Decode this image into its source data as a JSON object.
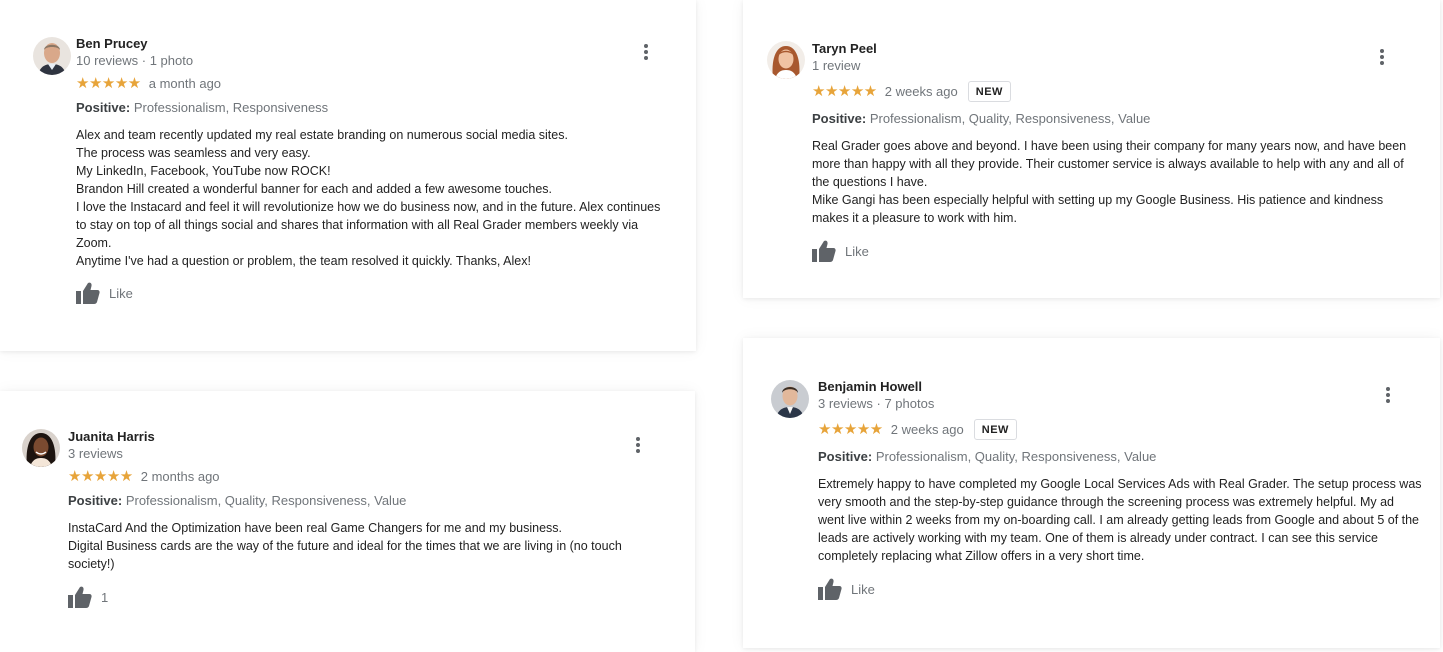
{
  "reviews": {
    "ben": {
      "name": "Ben Prucey",
      "meta": "10 reviews · 1 photo",
      "stars": "★★★★★",
      "time": "a month ago",
      "positive_label": "Positive:",
      "positive_values": "Professionalism, Responsiveness",
      "lines": [
        "Alex and team recently updated my real estate branding on numerous social media sites.",
        "The process was seamless and very easy.",
        "My LinkedIn, Facebook, YouTube now ROCK!",
        "Brandon Hill created a wonderful banner for each and added a few awesome touches.",
        "I love the Instacard and feel it will revolutionize how we do business now, and in the future.  Alex continues to stay on top of all things social and shares that information with all Real Grader members weekly via Zoom.",
        "Anytime I've had a question or problem, the team resolved it quickly.  Thanks, Alex!"
      ],
      "like_label": "Like"
    },
    "taryn": {
      "name": "Taryn Peel",
      "meta": "1 review",
      "stars": "★★★★★",
      "time": "2 weeks ago",
      "badge": "NEW",
      "positive_label": "Positive:",
      "positive_values": "Professionalism, Quality, Responsiveness, Value",
      "lines": [
        "Real Grader goes above and beyond.  I have been using their company for many years now, and have been more than happy with all they provide.  Their customer service is always available to help with any and all of the questions I have.",
        "Mike Gangi has been especially helpful with setting up my Google Business.  His patience and kindness makes it a pleasure to work with him."
      ],
      "like_label": "Like"
    },
    "juanita": {
      "name": "Juanita Harris",
      "meta": "3 reviews",
      "stars": "★★★★★",
      "time": "2 months ago",
      "positive_label": "Positive:",
      "positive_values": "Professionalism, Quality, Responsiveness, Value",
      "lines": [
        "InstaCard And the Optimization have been real Game Changers for me and my business.",
        "Digital Business cards are the way of the future and ideal for the times that we are living in (no touch society!)"
      ],
      "like_label": "1"
    },
    "benjamin": {
      "name": "Benjamin Howell",
      "meta": "3 reviews · 7 photos",
      "stars": "★★★★★",
      "time": "2 weeks ago",
      "badge": "NEW",
      "positive_label": "Positive:",
      "positive_values": "Professionalism, Quality, Responsiveness, Value",
      "lines": [
        "Extremely happy to have completed my Google Local Services Ads with Real Grader. The setup process was very smooth and the step-by-step guidance through the screening process was extremely helpful. My ad went live within 2 weeks from my on-boarding call. I am already getting leads from Google and about 5 of the leads are actively working with my team. One of them is already under contract.  I can see this service completely replacing what Zillow offers in a very short time."
      ],
      "like_label": "Like"
    }
  },
  "colors": {
    "star": "#e7a43a",
    "muted_text": "#70757a",
    "icon": "#5f6368"
  },
  "icons": {
    "like": "thumbs-up-icon",
    "more": "more-vert-icon"
  }
}
